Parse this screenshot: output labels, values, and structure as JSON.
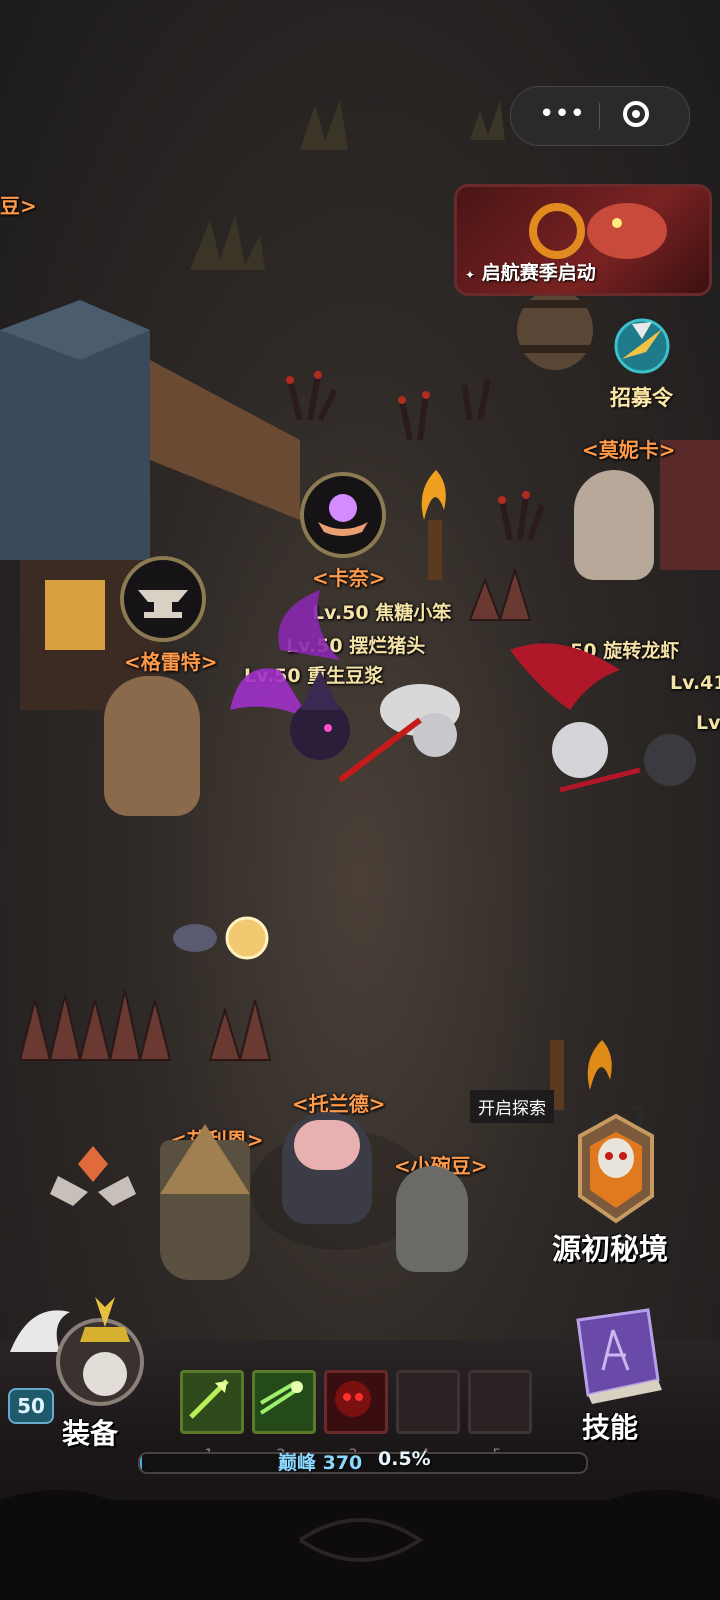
{
  "top_capsule": {
    "menu_icon": "more-dots-icon",
    "close_icon": "target-circle-icon"
  },
  "event_banner": {
    "label": "启航赛季启动",
    "icon": "diamond-sparkle-icon"
  },
  "recruit": {
    "label": "招募令",
    "icon": "compass-token-icon"
  },
  "npcs": {
    "offscreen_left": "豆>",
    "monica": "<莫妮卡>",
    "kanai": "<卡奈>",
    "gleite": "<格雷特>",
    "tuolande": "<托兰德>",
    "ailien": "<艾利恩>",
    "xiaowandou": "<小碗豆>"
  },
  "players": {
    "p1": "Lv.50 焦糖小笨",
    "p2": "Lv.50 摆烂猪头",
    "p3": "Lv.50 重生豆浆",
    "p4": "Lv.50 旋转龙虾",
    "p5": "Lv.41",
    "p6": "Lv"
  },
  "explore": {
    "tooltip": "开启探索",
    "label": "源初秘境"
  },
  "bottom": {
    "level": "50",
    "equip_label": "装备",
    "skill_label": "技能",
    "slot_numbers": [
      "1",
      "2",
      "3",
      "4",
      "5"
    ],
    "exp_text": "巅峰 370",
    "exp_percent": "0.5%",
    "exp_progress": 0.005
  },
  "colors": {
    "npc_name": "#ff9a4a",
    "player_name": "#f4e2a6",
    "accent_gold": "#c9a24a"
  }
}
